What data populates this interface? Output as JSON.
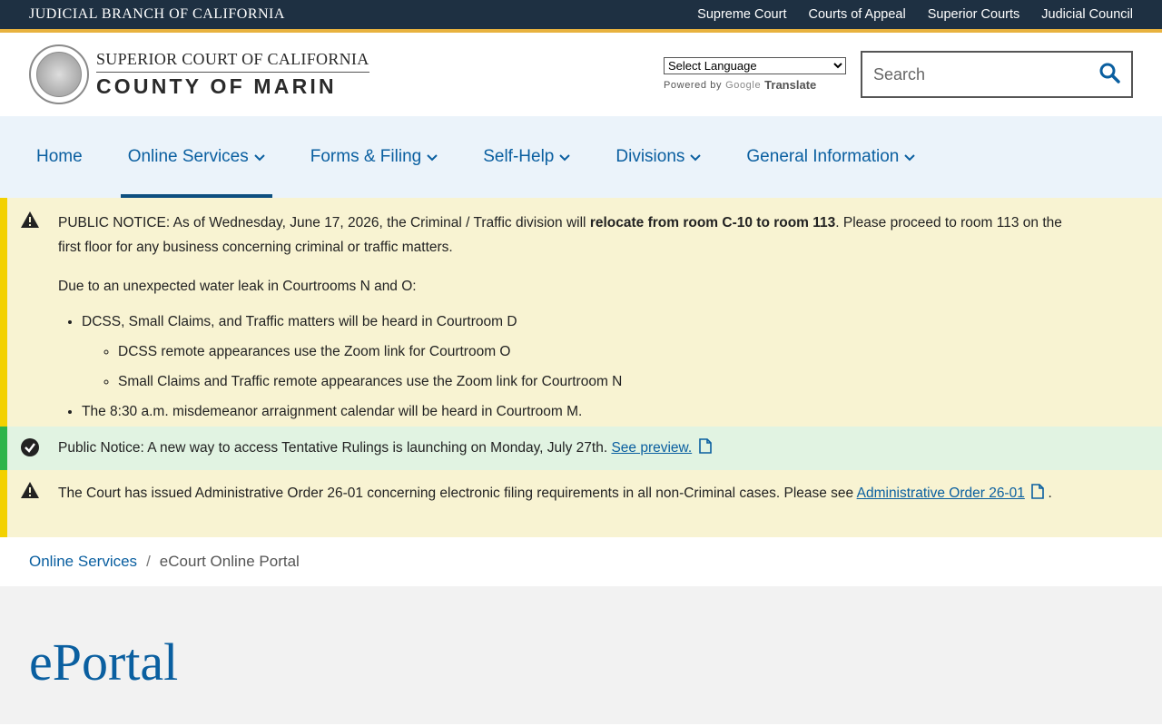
{
  "topbar": {
    "brand": "JUDICIAL BRANCH OF CALIFORNIA",
    "links": [
      "Supreme Court",
      "Courts of Appeal",
      "Superior Courts",
      "Judicial Council"
    ],
    "bg_color": "#1e3042",
    "accent_color": "#e8b23f"
  },
  "header": {
    "logo_line1": "SUPERIOR COURT OF CALIFORNIA",
    "logo_line2": "COUNTY OF MARIN",
    "translate": {
      "select_value": "Select Language",
      "powered_by": "Powered by",
      "google": "Google",
      "translate_label": "Translate"
    },
    "search": {
      "placeholder": "Search",
      "icon": "search-icon"
    }
  },
  "nav": {
    "items": [
      {
        "label": "Home",
        "has_dropdown": false,
        "active": false
      },
      {
        "label": "Online Services",
        "has_dropdown": true,
        "active": true
      },
      {
        "label": "Forms & Filing",
        "has_dropdown": true,
        "active": false
      },
      {
        "label": "Self-Help",
        "has_dropdown": true,
        "active": false
      },
      {
        "label": "Divisions",
        "has_dropdown": true,
        "active": false
      },
      {
        "label": "General Information",
        "has_dropdown": true,
        "active": false
      }
    ],
    "bg_color": "#ebf3fa",
    "link_color": "#0a5fa0"
  },
  "alerts": {
    "notice1": {
      "icon": "warning-icon",
      "intro": "PUBLIC NOTICE: As of Wednesday, June 17, 2026, the Criminal / Traffic division will ",
      "bold": "relocate from room C-10 to room 113",
      "rest": ".  Please proceed to room 113 on the first floor for any business concerning criminal or traffic matters.",
      "leak_intro": "Due to an unexpected water leak in Courtrooms N and O:",
      "bullet1": "DCSS, Small Claims, and Traffic matters will be heard in Courtroom D",
      "sub1": "DCSS remote appearances use the Zoom link for Courtroom O",
      "sub2": "Small Claims and Traffic remote appearances use the Zoom link for Courtroom N",
      "bullet2": "The 8:30 a.m. misdemeanor arraignment calendar will be heard in Courtroom M."
    },
    "notice2": {
      "icon": "check-circle-icon",
      "text": "Public Notice: A new way to access Tentative Rulings is launching on Monday, July 27th. ",
      "link": "See preview."
    },
    "notice3": {
      "icon": "warning-icon",
      "text": "The Court has issued Administrative Order 26-01 concerning electronic filing requirements in all non-Criminal cases. Please see ",
      "link": "Administrative Order 26-01",
      "after": "."
    },
    "warn_bg": "#f8f3d2",
    "warn_border": "#f3d100",
    "ok_bg": "#e1f3e2",
    "ok_border": "#2fb44a"
  },
  "breadcrumb": {
    "parent": "Online Services",
    "separator": "/",
    "current": "eCourt Online Portal"
  },
  "page": {
    "title": "ePortal"
  }
}
